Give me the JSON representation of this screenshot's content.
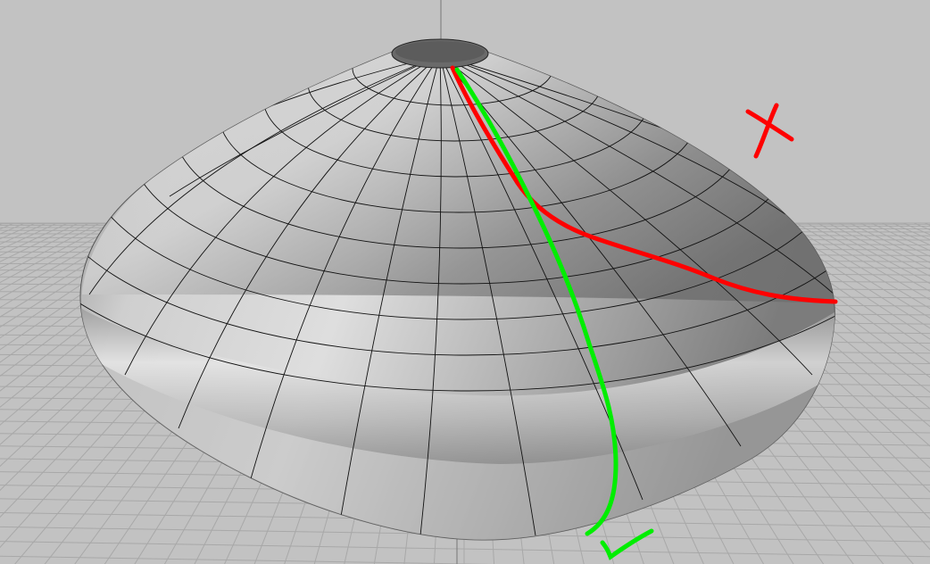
{
  "viewport": {
    "background": "#c2c2c2",
    "grid_color": "#a8a8a8",
    "surface_light": "#e4e4e4",
    "surface_dark": "#6e6e6e",
    "isocurve_color": "#111111"
  },
  "annotations": {
    "bad_curve_color": "#ff0000",
    "good_curve_color": "#00ee00",
    "bad_mark_icon": "cross-mark-icon",
    "good_mark_icon": "check-mark-icon"
  }
}
